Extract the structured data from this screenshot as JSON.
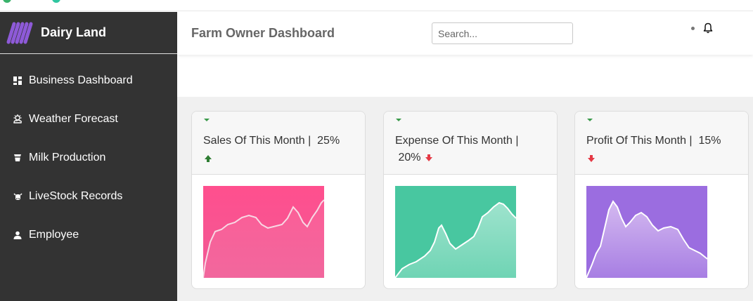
{
  "app": {
    "brand": "Dairy Land",
    "page_title": "Farm Owner Dashboard"
  },
  "search": {
    "placeholder": "Search...",
    "value": ""
  },
  "sidebar": {
    "items": [
      {
        "label": "Business Dashboard",
        "icon": "dashboard-icon"
      },
      {
        "label": "Weather Forecast",
        "icon": "weather-icon"
      },
      {
        "label": "Milk Production",
        "icon": "milk-icon"
      },
      {
        "label": "LiveStock Records",
        "icon": "cow-icon"
      },
      {
        "label": "Employee",
        "icon": "user-icon"
      }
    ]
  },
  "cards": [
    {
      "title": "Sales Of This Month |",
      "percent": "25%",
      "trend": "up",
      "color": "#f4508d",
      "trend_color": "#2e7d32"
    },
    {
      "title": "Expense Of This Month |",
      "percent": "20%",
      "trend": "down",
      "color": "#48c7a0",
      "trend_color": "#e53945"
    },
    {
      "title": "Profit Of This Month |",
      "percent": "15%",
      "trend": "down",
      "color": "#9b6de0",
      "trend_color": "#e53945"
    }
  ],
  "colors": {
    "sidebar_bg": "#333333",
    "content_bg": "#f0f0f0",
    "logo": "#8e5ad8"
  }
}
